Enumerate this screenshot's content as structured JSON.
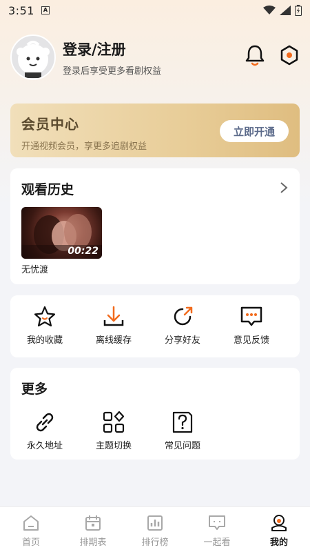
{
  "status_bar": {
    "time": "3:51",
    "notif_letter": "A"
  },
  "profile": {
    "login_title": "登录/注册",
    "login_subtitle": "登录后享受更多看剧权益"
  },
  "vip": {
    "title": "会员中心",
    "subtitle": "开通视频会员，享更多追剧权益",
    "button": "立即开通"
  },
  "history": {
    "title": "观看历史",
    "items": [
      {
        "title": "无忧渡",
        "duration": "00:22"
      }
    ]
  },
  "quick_actions": [
    {
      "label": "我的收藏",
      "icon": "star-icon"
    },
    {
      "label": "离线缓存",
      "icon": "download-icon"
    },
    {
      "label": "分享好友",
      "icon": "share-icon"
    },
    {
      "label": "意见反馈",
      "icon": "feedback-icon"
    }
  ],
  "more": {
    "title": "更多",
    "items": [
      {
        "label": "永久地址",
        "icon": "link-icon"
      },
      {
        "label": "主题切换",
        "icon": "theme-icon"
      },
      {
        "label": "常见问题",
        "icon": "faq-icon"
      }
    ]
  },
  "tabs": [
    {
      "label": "首页",
      "icon": "home-icon"
    },
    {
      "label": "排期表",
      "icon": "calendar-icon"
    },
    {
      "label": "排行榜",
      "icon": "ranking-icon"
    },
    {
      "label": "一起看",
      "icon": "chat-icon"
    },
    {
      "label": "我的",
      "icon": "profile-icon",
      "active": true
    }
  ],
  "colors": {
    "accent": "#f26b1d",
    "vip_gold": "#e8cd98"
  }
}
